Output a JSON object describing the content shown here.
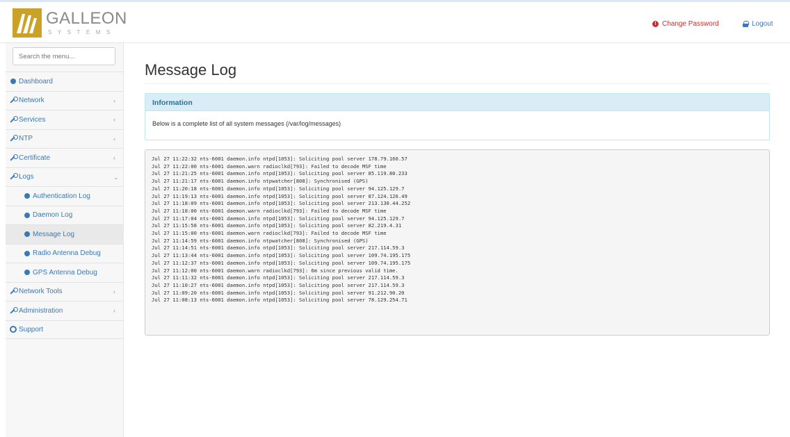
{
  "header": {
    "logo_title": "GALLEON",
    "logo_subtitle": "SYSTEMS",
    "change_password": "Change Password",
    "logout": "Logout"
  },
  "sidebar": {
    "search_placeholder": "Search the menu...",
    "items": [
      {
        "label": "Dashboard",
        "icon": "dashboard-icon"
      },
      {
        "label": "Network",
        "icon": "wrench-icon"
      },
      {
        "label": "Services",
        "icon": "wrench-icon"
      },
      {
        "label": "NTP",
        "icon": "wrench-icon"
      },
      {
        "label": "Certificate",
        "icon": "wrench-icon"
      },
      {
        "label": "Logs",
        "icon": "wrench-icon"
      },
      {
        "label": "Authentication Log",
        "icon": "circle-icon"
      },
      {
        "label": "Daemon Log",
        "icon": "circle-icon"
      },
      {
        "label": "Message Log",
        "icon": "circle-icon"
      },
      {
        "label": "Radio Antenna Debug",
        "icon": "circle-icon"
      },
      {
        "label": "GPS Antenna Debug",
        "icon": "circle-icon"
      },
      {
        "label": "Network Tools",
        "icon": "wrench-icon"
      },
      {
        "label": "Administration",
        "icon": "wrench-icon"
      },
      {
        "label": "Support",
        "icon": "lifebuoy-icon"
      }
    ]
  },
  "main": {
    "title": "Message Log",
    "info_heading": "Information",
    "info_text": "Below is a complete list of all system messages (/var/log/messages)",
    "log_lines": [
      "Jul 27 11:22:32 nts-6001 daemon.info ntpd[1053]: Soliciting pool server 178.79.160.57",
      "Jul 27 11:22:00 nts-6001 daemon.warn radioclkd[793]: Failed to decode MSF time",
      "Jul 27 11:21:25 nts-6001 daemon.info ntpd[1053]: Soliciting pool server 85.119.80.233",
      "Jul 27 11:21:17 nts-6001 daemon.info ntpwatcher[808]: Synchronised (GPS)",
      "Jul 27 11:20:18 nts-6001 daemon.info ntpd[1053]: Soliciting pool server 94.125.129.7",
      "Jul 27 11:19:13 nts-6001 daemon.info ntpd[1053]: Soliciting pool server 87.124.126.49",
      "Jul 27 11:18:09 nts-6001 daemon.info ntpd[1053]: Soliciting pool server 213.130.44.252",
      "Jul 27 11:18:00 nts-6001 daemon.warn radioclkd[793]: Failed to decode MSF time",
      "Jul 27 11:17:04 nts-6001 daemon.info ntpd[1053]: Soliciting pool server 94.125.129.7",
      "Jul 27 11:15:58 nts-6001 daemon.info ntpd[1053]: Soliciting pool server 82.219.4.31",
      "Jul 27 11:15:00 nts-6001 daemon.warn radioclkd[793]: Failed to decode MSF time",
      "Jul 27 11:14:59 nts-6001 daemon.info ntpwatcher[808]: Synchronised (GPS)",
      "Jul 27 11:14:51 nts-6001 daemon.info ntpd[1053]: Soliciting pool server 217.114.59.3",
      "Jul 27 11:13:44 nts-6001 daemon.info ntpd[1053]: Soliciting pool server 109.74.195.175",
      "Jul 27 11:12:37 nts-6001 daemon.info ntpd[1053]: Soliciting pool server 109.74.195.175",
      "Jul 27 11:12:00 nts-6001 daemon.warn radioclkd[793]: 6m since previous valid time.",
      "Jul 27 11:11:32 nts-6001 daemon.info ntpd[1053]: Soliciting pool server 217.114.59.3",
      "Jul 27 11:10:27 nts-6001 daemon.info ntpd[1053]: Soliciting pool server 217.114.59.3",
      "Jul 27 11:09:20 nts-6001 daemon.info ntpd[1053]: Soliciting pool server 91.212.90.20",
      "Jul 27 11:08:13 nts-6001 daemon.info ntpd[1053]: Soliciting pool server 78.129.254.71"
    ]
  },
  "colors": {
    "accent": "#3c78b5",
    "danger": "#c9302c",
    "info_bg": "#d9edf7",
    "info_text": "#31708f",
    "logo_gold": "#c9a227"
  }
}
